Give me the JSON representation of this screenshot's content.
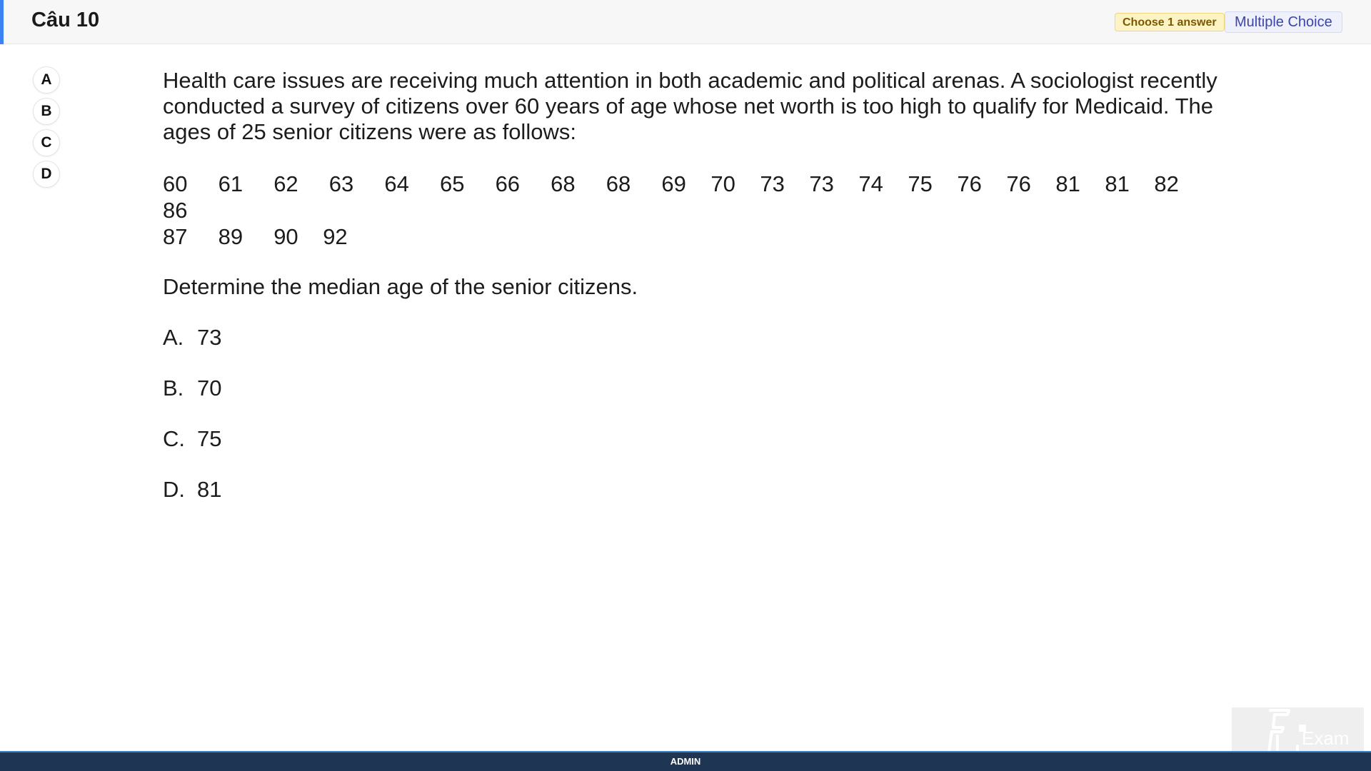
{
  "header": {
    "title": "Câu 10",
    "badge_choose": "Choose 1 answer",
    "badge_type": "Multiple Choice",
    "accent_color": "#3b82f6"
  },
  "answer_buttons": [
    "A",
    "B",
    "C",
    "D"
  ],
  "question": {
    "prompt": "Health care issues are receiving much attention in both academic and political arenas. A sociologist recently conducted a survey of citizens over 60 years of age whose net worth is too high to qualify for Medicaid. The ages of 25 senior citizens were as follows:",
    "ages_row1": [
      "60",
      "61",
      "62",
      "63",
      "64",
      "65",
      "66",
      "68",
      "68",
      "69",
      "70",
      "73",
      "73",
      "74",
      "75",
      "76",
      "76",
      "81",
      "81",
      "82",
      "86"
    ],
    "ages_row2": [
      "87",
      "89",
      "90",
      "92"
    ],
    "ask": "Determine the median age of the senior citizens.",
    "options": [
      {
        "letter": "A.",
        "value": "73"
      },
      {
        "letter": "B.",
        "value": "70"
      },
      {
        "letter": "C.",
        "value": "75"
      },
      {
        "letter": "D.",
        "value": "81"
      }
    ]
  },
  "footer": {
    "label": "ADMIN"
  },
  "watermark": {
    "logo_text": "Exam",
    "logo_icon": "fu-exam-logo"
  }
}
